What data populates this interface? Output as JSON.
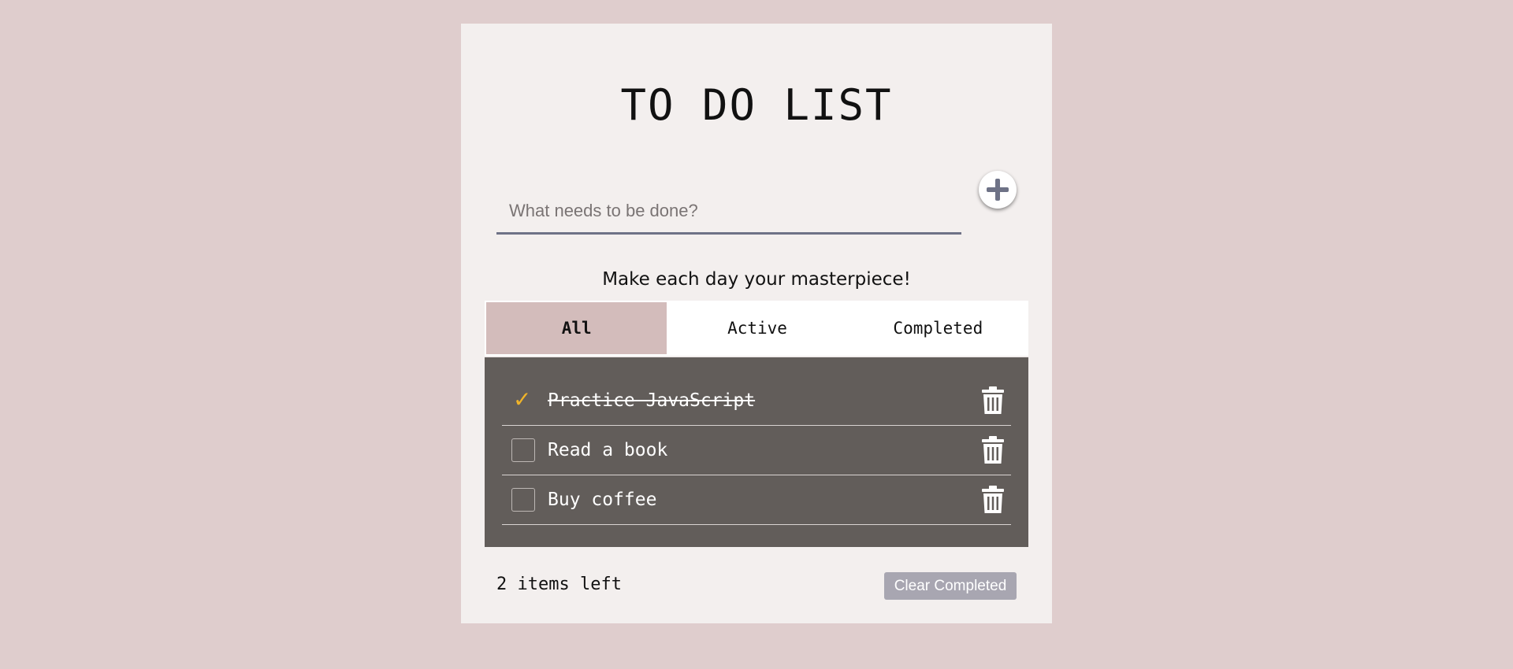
{
  "app": {
    "title": "TO DO LIST",
    "motto": "Make each day your masterpiece!"
  },
  "input": {
    "placeholder": "What needs to be done?",
    "value": ""
  },
  "add_button": {
    "icon": "plus-icon"
  },
  "tabs": [
    {
      "label": "All",
      "active": true
    },
    {
      "label": "Active",
      "active": false
    },
    {
      "label": "Completed",
      "active": false
    }
  ],
  "todos": [
    {
      "text": "Practice JavaScript",
      "completed": true
    },
    {
      "text": "Read a book",
      "completed": false
    },
    {
      "text": "Buy coffee",
      "completed": false
    }
  ],
  "footer": {
    "items_left": "2 items left",
    "clear_label": "Clear Completed"
  },
  "colors": {
    "page_bg": "#dfcdcd",
    "card_bg": "#f3efee",
    "list_bg": "#625d5a",
    "active_tab": "#d3bcbb",
    "accent": "#6e7286",
    "checkmark": "#f0b429",
    "clear_button": "#a8a6b1"
  }
}
